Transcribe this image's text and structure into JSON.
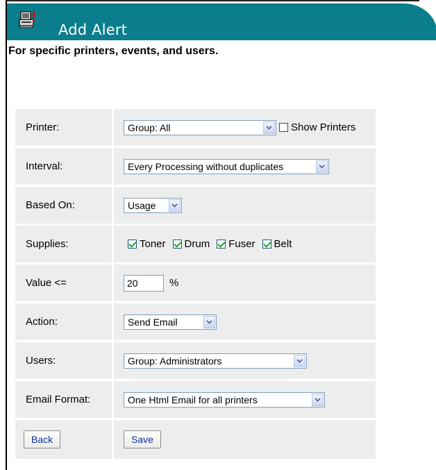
{
  "header": {
    "title": "Add Alert",
    "icon": "printer-alert-icon",
    "color": "#0a7e8c"
  },
  "subtitle": "For specific printers, events, and users.",
  "form": {
    "printer": {
      "label": "Printer:",
      "value": "Group: All",
      "show_printers_label": "Show Printers",
      "show_printers_checked": false
    },
    "interval": {
      "label": "Interval:",
      "value": "Every Processing without duplicates"
    },
    "based_on": {
      "label": "Based On:",
      "value": "Usage"
    },
    "supplies": {
      "label": "Supplies:",
      "items": [
        {
          "label": "Toner",
          "checked": true
        },
        {
          "label": "Drum",
          "checked": true
        },
        {
          "label": "Fuser",
          "checked": true
        },
        {
          "label": "Belt",
          "checked": true
        }
      ]
    },
    "value": {
      "label": "Value <=",
      "input": "20",
      "unit": "%"
    },
    "action": {
      "label": "Action:",
      "value": "Send Email"
    },
    "users": {
      "label": "Users:",
      "value": "Group: Administrators"
    },
    "email_format": {
      "label": "Email Format:",
      "value": "One Html Email for all printers"
    }
  },
  "buttons": {
    "back": "Back",
    "save": "Save"
  }
}
